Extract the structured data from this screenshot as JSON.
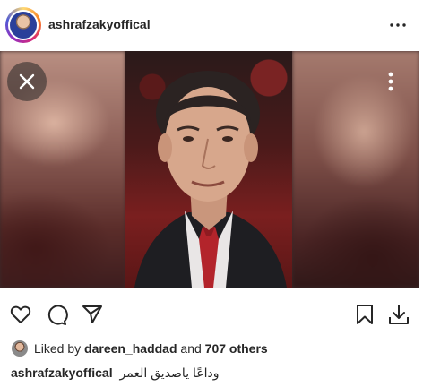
{
  "post": {
    "username": "ashrafzakyoffical",
    "likes": {
      "prefix": "Liked by",
      "user": "dareen_haddad",
      "middle": "and",
      "count_text": "707 others"
    },
    "caption": {
      "username": "ashrafzakyoffical",
      "text": "وداعًا ياصديق العمر"
    }
  },
  "icons": {
    "more": "more-horizontal-icon",
    "close": "close-icon",
    "media_more": "more-vertical-icon",
    "like": "heart-icon",
    "comment": "comment-icon",
    "share": "send-icon",
    "save": "bookmark-icon",
    "download": "download-icon"
  },
  "colors": {
    "text": "#262626",
    "border": "#dbdbdb",
    "overlay": "#262626"
  }
}
